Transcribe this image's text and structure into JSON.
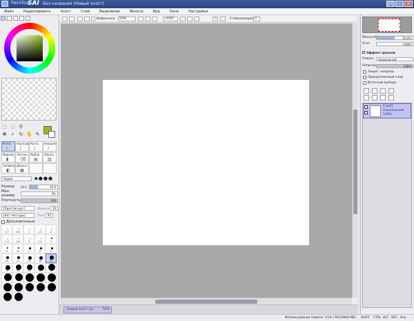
{
  "titlebar": {
    "app": "PaintTool",
    "sai": "SAI",
    "document": "Без названия (Новый холст)",
    "minimize": "_",
    "maximize": "□",
    "close": "×"
  },
  "menu": [
    "Файл",
    "Редактировать",
    "Холст",
    "Слой",
    "Выделение",
    "Фильтр",
    "Вид",
    "Окна",
    "Настройки"
  ],
  "toolbar": {
    "selection_label": "Выбранное",
    "zoom": "50%",
    "rotation": "+000°",
    "stabilizer_label": "Стабилизация",
    "stabilizer_value": "3",
    "flip_label": ">"
  },
  "left": {
    "tools_row1": [
      "select",
      "lasso",
      "wand",
      "hand"
    ],
    "tools_row2": [
      "move",
      "zoom",
      "rotate",
      "dropper",
      "eraser"
    ],
    "brush_rows": [
      [
        {
          "label": "Ручка",
          "icon": "/"
        },
        {
          "label": "Аэрограф",
          "icon": "/"
        },
        {
          "label": "Кисть",
          "icon": "/"
        },
        {
          "label": "Акварель",
          "icon": "/"
        }
      ],
      [
        {
          "label": "Маркер",
          "icon": "▮"
        },
        {
          "label": "Ластик",
          "icon": "⌫"
        },
        {
          "label": "Выбор",
          "icon": "▤"
        },
        {
          "label": "Убрать",
          "icon": "▥"
        }
      ],
      [
        {
          "label": "Заливка",
          "icon": "◧"
        },
        {
          "label": "Двоичн.",
          "icon": "▦"
        },
        {
          "label": "",
          "icon": ""
        },
        {
          "label": "",
          "icon": ""
        }
      ]
    ],
    "mode": "Норма",
    "size_label": "Размер",
    "size_multiplier": "x0.4",
    "size_value": "10.0",
    "min_size_label": "Мин. размер",
    "min_size_value": "0%",
    "density_label": "Плотность",
    "density_value": "100",
    "shape_dropdown": "[Простой круг]",
    "shape_value": "50",
    "shape_value_label": "Ширина",
    "texture_dropdown": "[Нет текстуры]",
    "texture_value": "95",
    "texture_value_label": "Тень",
    "advanced_label": "Дополнительно",
    "brush_sizes": [
      {
        "n": "0.7",
        "d": 1
      },
      {
        "n": "0.8",
        "d": 1
      },
      {
        "n": "1",
        "d": 1
      },
      {
        "n": "1.5",
        "d": 1
      },
      {
        "n": "2",
        "d": 1
      },
      {
        "n": "2.3",
        "d": 1
      },
      {
        "n": "2.6",
        "d": 1
      },
      {
        "n": "3",
        "d": 1
      },
      {
        "n": "3.5",
        "d": 1
      },
      {
        "n": "4",
        "d": 2
      },
      {
        "n": "5",
        "d": 2
      },
      {
        "n": "6",
        "d": 2
      },
      {
        "n": "7",
        "d": 3
      },
      {
        "n": "8",
        "d": 3
      },
      {
        "n": "9",
        "d": 3
      },
      {
        "n": "10",
        "d": 4
      },
      {
        "n": "12",
        "d": 4
      },
      {
        "n": "14",
        "d": 5
      },
      {
        "n": "16",
        "d": 5
      },
      {
        "n": "20",
        "d": 6
      },
      {
        "n": "25",
        "d": 7
      },
      {
        "n": "30",
        "d": 8
      },
      {
        "n": "35",
        "d": 8
      },
      {
        "n": "40",
        "d": 9
      },
      {
        "n": "50",
        "d": 10
      },
      {
        "n": "60",
        "d": 11
      },
      {
        "n": "70",
        "d": 11
      },
      {
        "n": "80",
        "d": 12
      },
      {
        "n": "100",
        "d": 12
      },
      {
        "n": "120",
        "d": 12
      },
      {
        "n": "160",
        "d": 12
      },
      {
        "n": "200",
        "d": 12
      },
      {
        "n": "250",
        "d": 12
      },
      {
        "n": "300",
        "d": 12
      },
      {
        "n": "350",
        "d": 12
      },
      {
        "n": "400",
        "d": 12
      },
      {
        "n": "500",
        "d": 12
      }
    ],
    "selected_size_index": 19
  },
  "right": {
    "zoom_label": "Масштаб",
    "zoom_value": "50.0%",
    "angle_label": "Угол",
    "angle_value": "+000$",
    "effects_label": "Эффект деколи",
    "blend_label": "Режим",
    "blend_value": "Нормальный",
    "opacity_label": "Непрозрачн.",
    "opacity_value": "100%",
    "checks": [
      "Защит. непрозр.",
      "Прикрепленный слой",
      "Источник выбора"
    ],
    "layer": {
      "name": "Слой1",
      "mode": "Нормальный",
      "opacity": "100%"
    }
  },
  "doctab": {
    "name": "Новый холст.sai",
    "zoom": "50%"
  },
  "status": {
    "memory": "Использование памяти: 21% (762/3840 МБ)",
    "indicators": [
      "SHIFT",
      "CTRL",
      "ALT",
      "SPC",
      "Any"
    ]
  },
  "colors": {
    "foreground": "#8fbf1e",
    "background": "#ffffff",
    "canvas_bg": "#a9a9a9"
  }
}
